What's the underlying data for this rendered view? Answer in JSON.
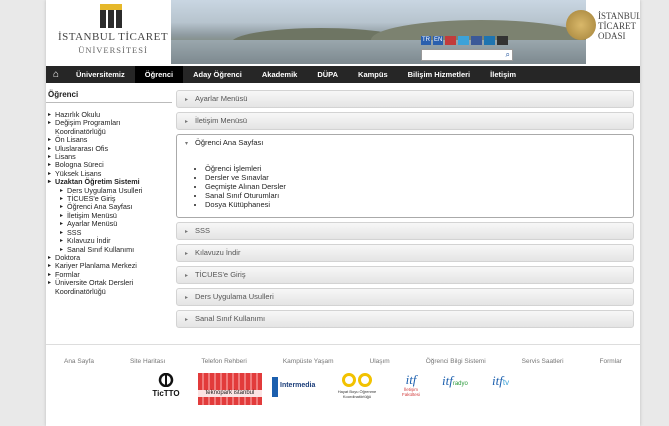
{
  "header": {
    "uni_name": "İSTANBUL TİCARET",
    "uni_sub": "ÜNİVERSİTESİ",
    "social": [
      "TR",
      "EN"
    ],
    "ito": [
      "İSTANBUL",
      "TİCARET",
      "ODASI"
    ]
  },
  "nav": {
    "items": [
      "Üniversitemiz",
      "Öğrenci",
      "Aday Öğrenci",
      "Akademik",
      "DÜPA",
      "Kampüs",
      "Bilişim Hizmetleri",
      "İletişim"
    ]
  },
  "sidebar": {
    "title": "Öğrenci",
    "items": [
      {
        "label": "Hazırlık Okulu",
        "level": 0
      },
      {
        "label": "Değişim Programları Koordinatörlüğü",
        "level": 0
      },
      {
        "label": "Ön Lisans",
        "level": 0
      },
      {
        "label": "Uluslararası Ofis",
        "level": 0
      },
      {
        "label": "Lisans",
        "level": 0
      },
      {
        "label": "Bologna Süreci",
        "level": 0
      },
      {
        "label": "Yüksek Lisans",
        "level": 0
      },
      {
        "label": "Uzaktan Öğretim Sistemi",
        "level": 0,
        "bold": true
      },
      {
        "label": "Ders Uygulama Usulleri",
        "level": 1
      },
      {
        "label": "TİCUES'e Giriş",
        "level": 1
      },
      {
        "label": "Öğrenci Ana Sayfası",
        "level": 1
      },
      {
        "label": "İletişim Menüsü",
        "level": 1
      },
      {
        "label": "Ayarlar Menüsü",
        "level": 1
      },
      {
        "label": "SSS",
        "level": 1
      },
      {
        "label": "Kılavuzu İndir",
        "level": 1
      },
      {
        "label": "Sanal Sınıf Kullanımı",
        "level": 1
      },
      {
        "label": "Doktora",
        "level": 0
      },
      {
        "label": "Kariyer Planlama Merkezi",
        "level": 0
      },
      {
        "label": "Formlar",
        "level": 0
      },
      {
        "label": "Üniversite Ortak Dersleri Koordinatörlüğü",
        "level": 0
      }
    ]
  },
  "accordion": {
    "before": [
      "Ayarlar Menüsü",
      "İletişim Menüsü"
    ],
    "open_title": "Öğrenci Ana Sayfası",
    "open_items": [
      "Öğrenci İşlemleri",
      "Dersler ve Sınavlar",
      "Geçmişte Alınan Dersler",
      "Sanal Sınıf Oturumları",
      "Dosya Kütüphanesi"
    ],
    "after": [
      "SSS",
      "Kılavuzu İndir",
      "TİCUES'e Giriş",
      "Ders Uygulama Usulleri",
      "Sanal Sınıf Kullanımı"
    ]
  },
  "footer": {
    "links": [
      "Ana Sayfa",
      "Site Haritası",
      "Telefon Rehberi",
      "Kampüste Yaşam",
      "Ulaşım",
      "Öğrenci Bilgi Sistemi",
      "Servis Saatleri",
      "Formlar"
    ],
    "logos": {
      "tictto": "TicTTO",
      "teknopark": "teknopark istanbul",
      "intermedia": "Intermedia",
      "hayat": "Hayat Boyu Öğrenme Koordinatörlüğü",
      "itf_fakulte": "İletişim Fakültesi",
      "itf_radyo": "radyo",
      "itf_tv": "tv"
    }
  }
}
